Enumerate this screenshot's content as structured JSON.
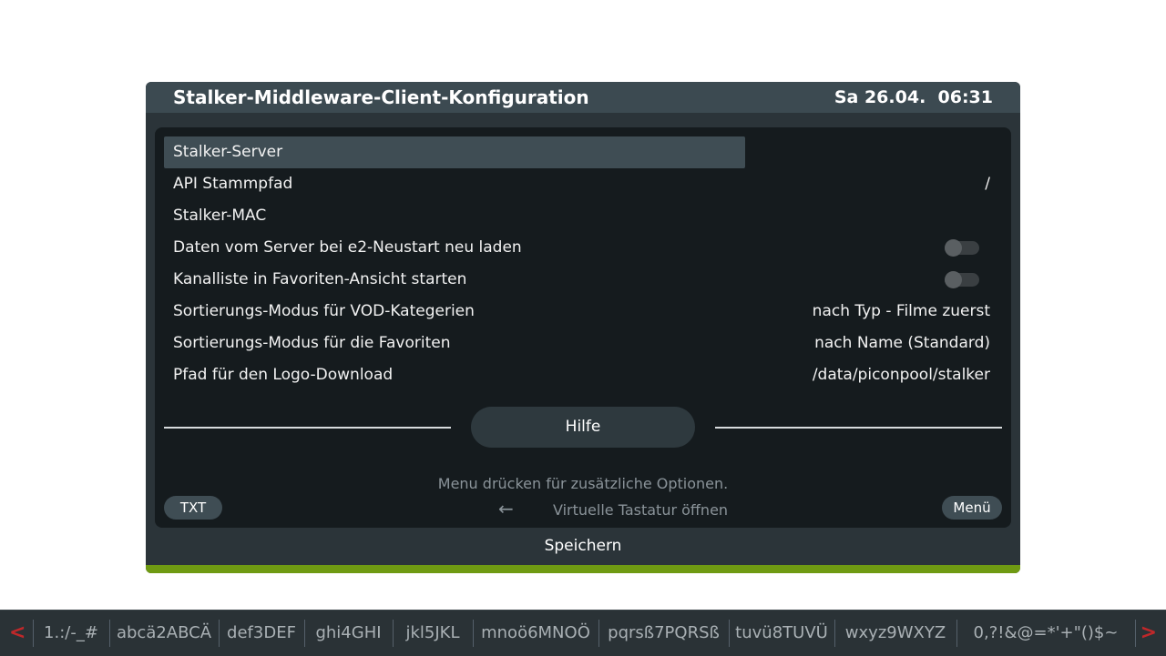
{
  "header": {
    "title": "Stalker-Middleware-Client-Konfiguration",
    "datetime": "Sa 26.04.  06:31"
  },
  "settings": [
    {
      "label": "Stalker-Server",
      "value": ""
    },
    {
      "label": "API Stammpfad",
      "value": "/"
    },
    {
      "label": "Stalker-MAC",
      "value": ""
    },
    {
      "label": "Daten vom Server bei e2-Neustart neu laden",
      "toggle": false
    },
    {
      "label": "Kanalliste in Favoriten-Ansicht starten",
      "toggle": false
    },
    {
      "label": "Sortierungs-Modus für VOD-Kategerien",
      "value": "nach Typ - Filme zuerst"
    },
    {
      "label": "Sortierungs-Modus für die Favoriten",
      "value": "nach Name (Standard)"
    },
    {
      "label": "Pfad für den Logo-Download",
      "value": "/data/piconpool/stalker"
    }
  ],
  "help_label": "Hilfe",
  "hints": {
    "menu_hint": "Menu drücken für zusätzliche Optionen.",
    "keyboard_hint": "Virtuelle Tastatur öffnen",
    "arrow_icon": "left-arrow-icon"
  },
  "buttons": {
    "txt": "TXT",
    "menu": "Menü"
  },
  "footer": {
    "save": "Speichern"
  },
  "keyboard": {
    "left_arrow": "<",
    "right_arrow": ">",
    "keys": [
      "1.:/-_#",
      "abcä2ABCÄ",
      "def3DEF",
      "ghi4GHI",
      "jkl5JKL",
      "mnoö6MNOÖ",
      "pqrsß7PQRSß",
      "tuvü8TUVÜ",
      "wxyz9WXYZ",
      "0,?!&@=*'+\"()$~"
    ]
  },
  "colors": {
    "accent_green": "#6f9a12",
    "arrow_red": "#c0282a",
    "selection": "#3f4d54"
  }
}
